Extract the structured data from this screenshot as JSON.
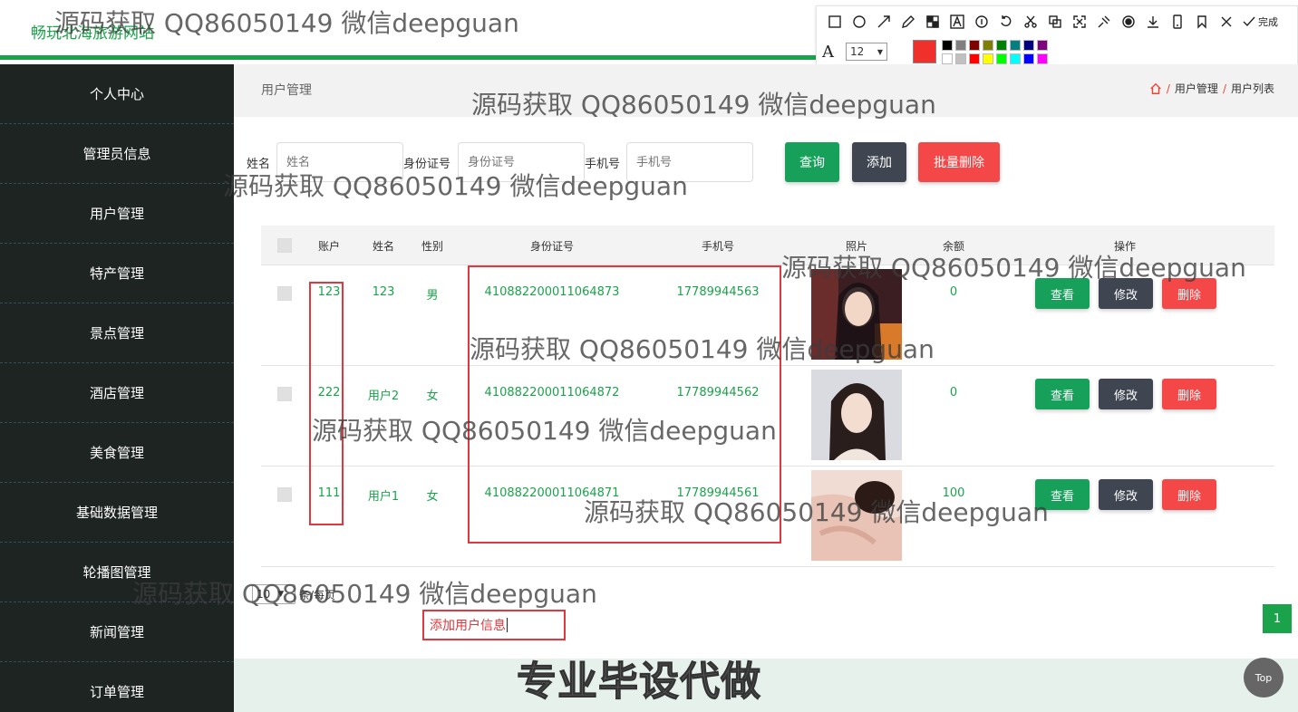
{
  "header": {
    "site_title": "畅玩北海旅游网站"
  },
  "annotation_toolbar": {
    "done_label": "完成",
    "font_size": "12",
    "current_color": "#f0302b",
    "swatch_colors": [
      "#000000",
      "#808080",
      "#800000",
      "#808000",
      "#008000",
      "#008080",
      "#000080",
      "#800080",
      "#ffffff",
      "#c0c0c0",
      "#ff0000",
      "#ffff00",
      "#00ff00",
      "#00ffff",
      "#0000ff",
      "#ff00ff"
    ],
    "tools": [
      "rect-icon",
      "ellipse-icon",
      "arrow-icon",
      "pen-icon",
      "mosaic-icon",
      "text-icon",
      "number-icon",
      "undo-icon",
      "crop-icon",
      "copy-icon",
      "fullscreen-icon",
      "pin-icon",
      "record-icon",
      "download-icon",
      "phone-icon",
      "bookmark-icon",
      "close-icon",
      "check-icon"
    ]
  },
  "sidebar": {
    "items": [
      "个人中心",
      "管理员信息",
      "用户管理",
      "特产管理",
      "景点管理",
      "酒店管理",
      "美食管理",
      "基础数据管理",
      "轮播图管理",
      "新闻管理",
      "订单管理"
    ]
  },
  "page": {
    "title": "用户管理",
    "breadcrumb": [
      "用户管理",
      "用户列表"
    ]
  },
  "search": {
    "name_label": "姓名",
    "name_placeholder": "姓名",
    "id_label": "身份证号",
    "id_placeholder": "身份证号",
    "phone_label": "手机号",
    "phone_placeholder": "手机号",
    "query_label": "查询",
    "add_label": "添加",
    "batch_delete_label": "批量删除"
  },
  "table": {
    "headers": [
      "账户",
      "姓名",
      "性别",
      "身份证号",
      "手机号",
      "照片",
      "余额",
      "操作"
    ],
    "rows": [
      {
        "account": "123",
        "name": "123",
        "gender": "男",
        "id_number": "410882200011064873",
        "phone": "17789944563",
        "balance": "0"
      },
      {
        "account": "222",
        "name": "用户2",
        "gender": "女",
        "id_number": "410882200011064872",
        "phone": "17789944562",
        "balance": "0"
      },
      {
        "account": "111",
        "name": "用户1",
        "gender": "女",
        "id_number": "410882200011064871",
        "phone": "17789944561",
        "balance": "100"
      }
    ],
    "view_label": "查看",
    "edit_label": "修改",
    "delete_label": "删除"
  },
  "pagination": {
    "page_size": "10",
    "page_size_label": "条/每页",
    "current_page": "1"
  },
  "annotation_text": "添加用户信息",
  "promo": "专业毕设代做",
  "top_button": "Top",
  "watermark": "源码获取 QQ86050149 微信deepguan",
  "colors": {
    "brand": "#1aa34a",
    "sidebar": "#1e2422",
    "query_button": "#16a05a",
    "add_button": "#3f4652",
    "delete_button": "#f44848",
    "annotation_red": "#e0383e"
  }
}
